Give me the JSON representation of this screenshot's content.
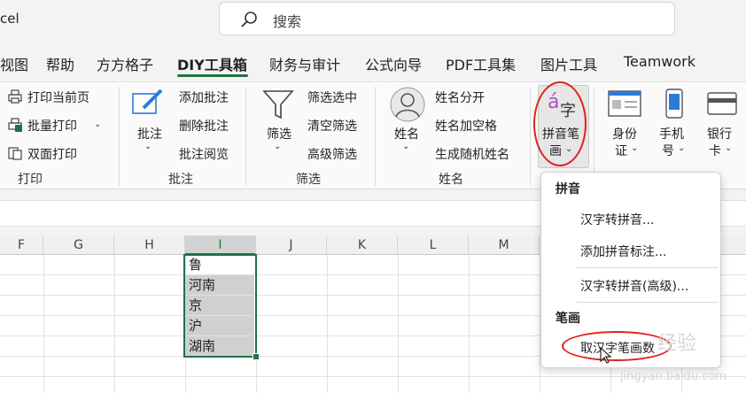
{
  "title_bar": {
    "app_title": "cel",
    "search_placeholder": "搜索"
  },
  "tabs": [
    {
      "label": "视图"
    },
    {
      "label": "帮助"
    },
    {
      "label": "方方格子"
    },
    {
      "label": "DIY工具箱",
      "active": true
    },
    {
      "label": "财务与审计"
    },
    {
      "label": "公式向导"
    },
    {
      "label": "PDF工具集"
    },
    {
      "label": "图片工具"
    },
    {
      "label": "Teamwork"
    }
  ],
  "ribbon": {
    "print": {
      "current_page": "打印当前页",
      "batch": "批量打印",
      "duplex": "双面打印",
      "group": "打印"
    },
    "comment": {
      "button": "批注",
      "add": "添加批注",
      "delete": "删除批注",
      "review": "批注阅览",
      "group": "批注"
    },
    "filter": {
      "button": "筛选",
      "selected": "筛选选中",
      "clear": "清空筛选",
      "advanced": "高级筛选",
      "group": "筛选"
    },
    "name": {
      "button": "姓名",
      "split": "姓名分开",
      "add_space": "姓名加空格",
      "random": "生成随机姓名",
      "group": "姓名"
    },
    "pinyin_stroke": {
      "line1": "拼音笔",
      "line2": "画",
      "glyph_a": "á",
      "glyph_zi": "字"
    },
    "id": {
      "line1": "身份",
      "line2": "证"
    },
    "phone": {
      "line1": "手机",
      "line2": "号"
    },
    "bank": {
      "line1": "银行",
      "line2": "卡"
    }
  },
  "sheet": {
    "columns": [
      "F",
      "G",
      "H",
      "I",
      "J",
      "K",
      "L",
      "M"
    ],
    "selected_column": "I",
    "cells": [
      "鲁",
      "河南",
      "京",
      "沪",
      "湖南"
    ]
  },
  "menu": {
    "section1": "拼音",
    "item1": "汉字转拼音...",
    "item2": "添加拼音标注...",
    "item3": "汉字转拼音(高级)...",
    "section2": "笔画",
    "item4": "取汉字笔画数"
  },
  "watermark": {
    "main": "经验",
    "sub": "jingyan.baidu.com"
  },
  "colors": {
    "accent": "#217346",
    "annotation": "#e0221b",
    "pinyin_glyph": "#b050c8"
  }
}
